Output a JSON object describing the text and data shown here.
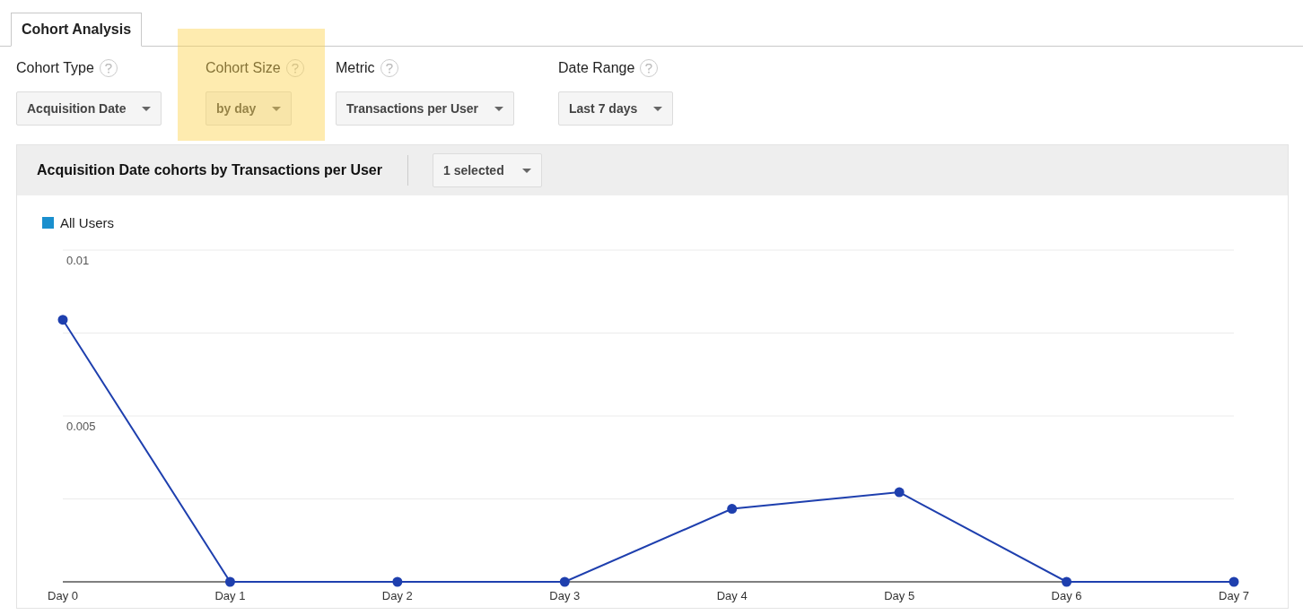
{
  "tabs": [
    {
      "label": "Cohort Analysis",
      "selected": true
    }
  ],
  "controls": [
    {
      "label": "Cohort Type",
      "value": "Acquisition Date",
      "highlighted": false
    },
    {
      "label": "Cohort Size",
      "value": "by day",
      "highlighted": true
    },
    {
      "label": "Metric",
      "value": "Transactions per User",
      "highlighted": false
    },
    {
      "label": "Date Range",
      "value": "Last 7 days",
      "highlighted": false
    }
  ],
  "chart_panel": {
    "title": "Acquisition Date cohorts by Transactions per User",
    "selector": "1 selected",
    "legend": {
      "color": "#1a8fce"
    },
    "chart_data": {
      "type": "line",
      "categories": [
        "Day 0",
        "Day 1",
        "Day 2",
        "Day 3",
        "Day 4",
        "Day 5",
        "Day 6",
        "Day 7"
      ],
      "ylim": [
        0,
        0.01
      ],
      "yticks": [
        {
          "value": 0.005,
          "label": "0.005"
        },
        {
          "value": 0.01,
          "label": "0.01"
        }
      ],
      "series": [
        {
          "name": "All Users",
          "color": "#1e3fae",
          "marker": "circle",
          "values": [
            0.0079,
            0,
            0,
            0,
            0.0022,
            0.0027,
            0,
            0
          ]
        }
      ]
    }
  }
}
